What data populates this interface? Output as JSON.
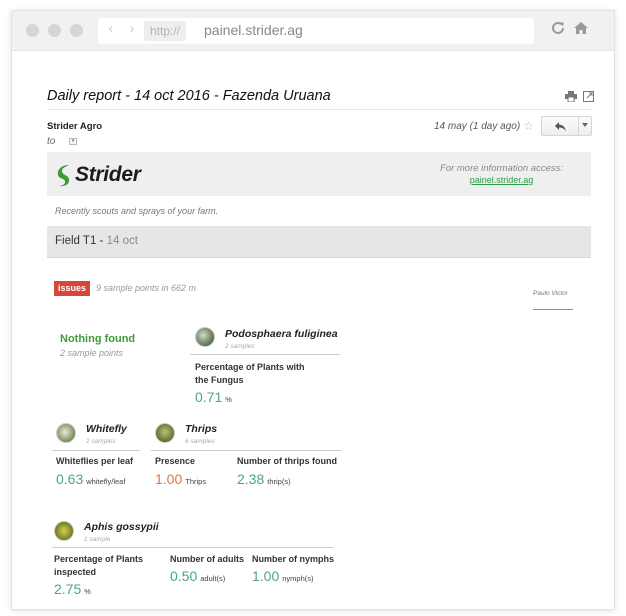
{
  "browser": {
    "protocol": "http://",
    "url": "painel.strider.ag",
    "nav_arrows": "‹ ›"
  },
  "email": {
    "subject": "Daily report - 14 oct 2016 - Fazenda Uruana",
    "sender": "Strider Agro",
    "to_label": "to",
    "date": "14 may (1 day ago)"
  },
  "banner": {
    "logo_text": "Strider",
    "more_info_label": "For more information access:",
    "more_info_link": "painel.strider.ag"
  },
  "tagline": "Recently scouts and sprays of your farm.",
  "field": {
    "name": "Field T1",
    "separator": " - ",
    "date": "14 oct"
  },
  "issues": {
    "badge": "issues",
    "summary": "9 sample points in 662 m",
    "scout": "Paulo Victor"
  },
  "nothing_found": {
    "title": "Nothing found",
    "subtitle": "2 sample points"
  },
  "pests": [
    {
      "name": "Podosphaera fuliginea",
      "samples": "2 samples",
      "metrics": [
        {
          "label_line1": "Percentage of Plants with",
          "label_line2": "the Fungus",
          "value": "0.71",
          "unit": "%"
        }
      ]
    },
    {
      "name": "Whitefly",
      "samples": "2 samples",
      "metrics": [
        {
          "label_line1": "Whiteflies per leaf",
          "value": "0.63",
          "unit": "whitefly/leaf"
        }
      ]
    },
    {
      "name": "Thrips",
      "samples": "6 samples",
      "metrics": [
        {
          "label_line1": "Presence",
          "value": "1.00",
          "unit": "Thrips"
        },
        {
          "label_line1": "Number of thrips found",
          "value": "2.38",
          "unit": "thrip(s)"
        }
      ]
    },
    {
      "name": "Aphis gossypii",
      "samples": "1 sample",
      "metrics": [
        {
          "label_line1": "Percentage of Plants",
          "label_line2": "inspected",
          "value": "2.75",
          "unit": "%"
        },
        {
          "label_line1": "Number of adults",
          "value": "0.50",
          "unit": "adult(s)"
        },
        {
          "label_line1": "Number of nymphs",
          "value": "1.00",
          "unit": "nymph(s)"
        }
      ]
    }
  ],
  "colors": {
    "accent_green": "#3f9a3a",
    "value_teal": "#4aa87e",
    "warning_orange": "#e0754a",
    "issues_red": "#d8453b"
  },
  "icons": [
    "reload-icon",
    "home-icon",
    "print-icon",
    "popout-icon",
    "star-icon",
    "reply-icon",
    "more-caret-icon",
    "strider-leaf-logo",
    "pest-thumbnail"
  ]
}
